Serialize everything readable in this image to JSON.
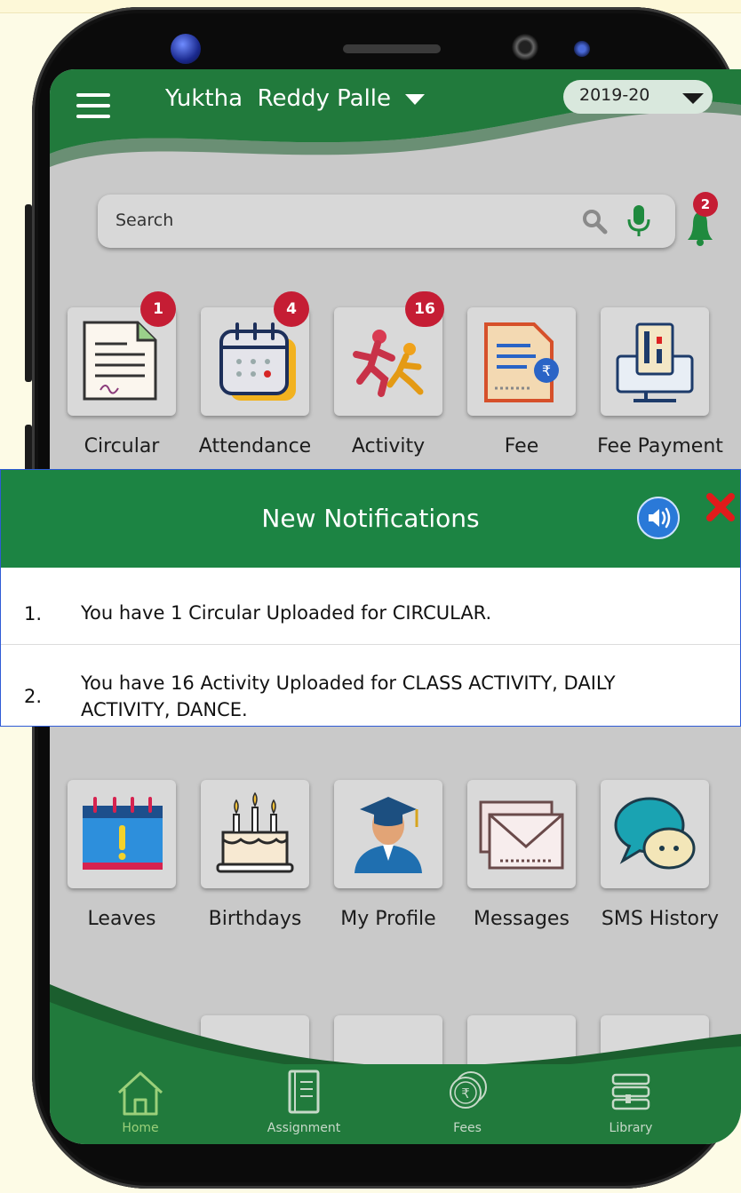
{
  "header": {
    "user_name": "Yuktha  Reddy Palle",
    "academic_year": "2019-20"
  },
  "search": {
    "placeholder": "Search"
  },
  "notifications_bell": {
    "count": "2"
  },
  "modules_row1": [
    {
      "label": "Circular",
      "badge": "1",
      "icon": "circular-document-icon"
    },
    {
      "label": "Attendance",
      "badge": "4",
      "icon": "calendar-icon"
    },
    {
      "label": "Activity",
      "badge": "16",
      "icon": "running-people-icon"
    },
    {
      "label": "Fee",
      "icon": "fee-invoice-icon"
    },
    {
      "label": "Fee Payment",
      "icon": "payment-terminal-icon"
    }
  ],
  "modules_row2": [
    {
      "label": "Leaves",
      "icon": "leave-calendar-icon"
    },
    {
      "label": "Birthdays",
      "icon": "birthday-cake-icon"
    },
    {
      "label": "My Profile",
      "icon": "graduate-profile-icon"
    },
    {
      "label": "Messages",
      "icon": "envelope-icon"
    },
    {
      "label": "SMS History",
      "icon": "chat-bubbles-icon"
    }
  ],
  "bottom_nav": [
    {
      "label": "Home",
      "icon": "home-icon",
      "active": true
    },
    {
      "label": "Assignment",
      "icon": "assignment-book-icon"
    },
    {
      "label": "Fees",
      "icon": "rupee-coins-icon"
    },
    {
      "label": "Library",
      "icon": "library-books-icon"
    }
  ],
  "popup": {
    "title": "New Notifications",
    "items": [
      {
        "number": "1.",
        "text": "You have 1 Circular Uploaded for  CIRCULAR."
      },
      {
        "number": "2.",
        "text": "You have 16 Activity Uploaded for  CLASS ACTIVITY, DAILY ACTIVITY, DANCE."
      }
    ]
  },
  "colors": {
    "brand_green": "#1c8443",
    "badge_red": "#c51d34",
    "speaker_blue": "#2a79d8",
    "close_red": "#e01b1b"
  }
}
